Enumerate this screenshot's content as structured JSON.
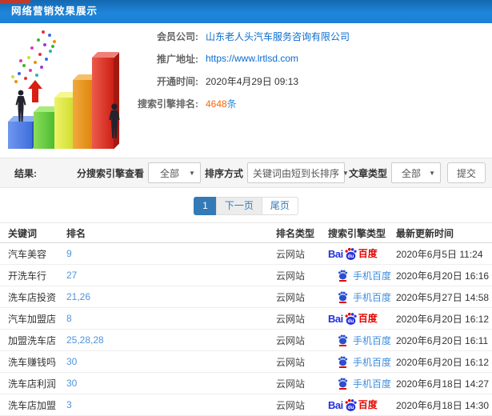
{
  "header": {
    "title": "网络营销效果展示"
  },
  "member_info": {
    "company_label": "会员公司:",
    "company_value": "山东老人头汽车服务咨询有限公司",
    "url_label": "推广地址:",
    "url_value": "https://www.lrtlsd.com",
    "open_time_label": "开通时间:",
    "open_time_value": "2020年4月29日 09:13",
    "rank_label": "搜索引擎排名:",
    "rank_count": "4648",
    "rank_unit": "条"
  },
  "filters": {
    "result_label": "结果:",
    "engine_label": "分搜索引擎查看",
    "engine_value": "全部",
    "sort_label": "排序方式",
    "sort_value": "关键词由短到长排序",
    "article_label": "文章类型",
    "article_value": "全部",
    "submit_label": "提交"
  },
  "pagination": {
    "current": "1",
    "next": "下一页",
    "last": "尾页"
  },
  "table": {
    "headers": [
      "关键词",
      "排名",
      "排名类型",
      "搜索引擎类型",
      "最新更新时间"
    ],
    "engine_labels": {
      "pc_bai": "Bai",
      "pc_du": "du",
      "pc_cn": "百度",
      "mobile": "手机百度"
    },
    "rows": [
      {
        "keyword": "汽车美容",
        "rank": "9",
        "rank_type": "云网站",
        "engine": "baidu_pc",
        "time": "2020年6月5日 11:24"
      },
      {
        "keyword": "开洗车行",
        "rank": "27",
        "rank_type": "云网站",
        "engine": "baidu_mobile",
        "time": "2020年6月20日 16:16"
      },
      {
        "keyword": "洗车店投资",
        "rank": "21,26",
        "rank_type": "云网站",
        "engine": "baidu_mobile",
        "time": "2020年5月27日 14:58"
      },
      {
        "keyword": "汽车加盟店",
        "rank": "8",
        "rank_type": "云网站",
        "engine": "baidu_pc",
        "time": "2020年6月20日 16:12"
      },
      {
        "keyword": "加盟洗车店",
        "rank": "25,28,28",
        "rank_type": "云网站",
        "engine": "baidu_mobile",
        "time": "2020年6月20日 16:11"
      },
      {
        "keyword": "洗车赚钱吗",
        "rank": "30",
        "rank_type": "云网站",
        "engine": "baidu_mobile",
        "time": "2020年6月20日 16:12"
      },
      {
        "keyword": "洗车店利润",
        "rank": "30",
        "rank_type": "云网站",
        "engine": "baidu_mobile",
        "time": "2020年6月18日 14:27"
      },
      {
        "keyword": "洗车店加盟",
        "rank": "3",
        "rank_type": "云网站",
        "engine": "baidu_pc",
        "time": "2020年6月18日 14:30"
      }
    ]
  },
  "colors": {
    "header_blue": "#1e85da",
    "link_blue": "#0a6cce",
    "rank_orange": "#ff6600",
    "rank_link_blue": "#4f94dd",
    "pagination_active": "#337ab7",
    "baidu_blue": "#2433da",
    "baidu_red": "#e10600",
    "mobile_text_blue": "#3f8ede",
    "filter_bar_bg": "#f5f5f5"
  }
}
